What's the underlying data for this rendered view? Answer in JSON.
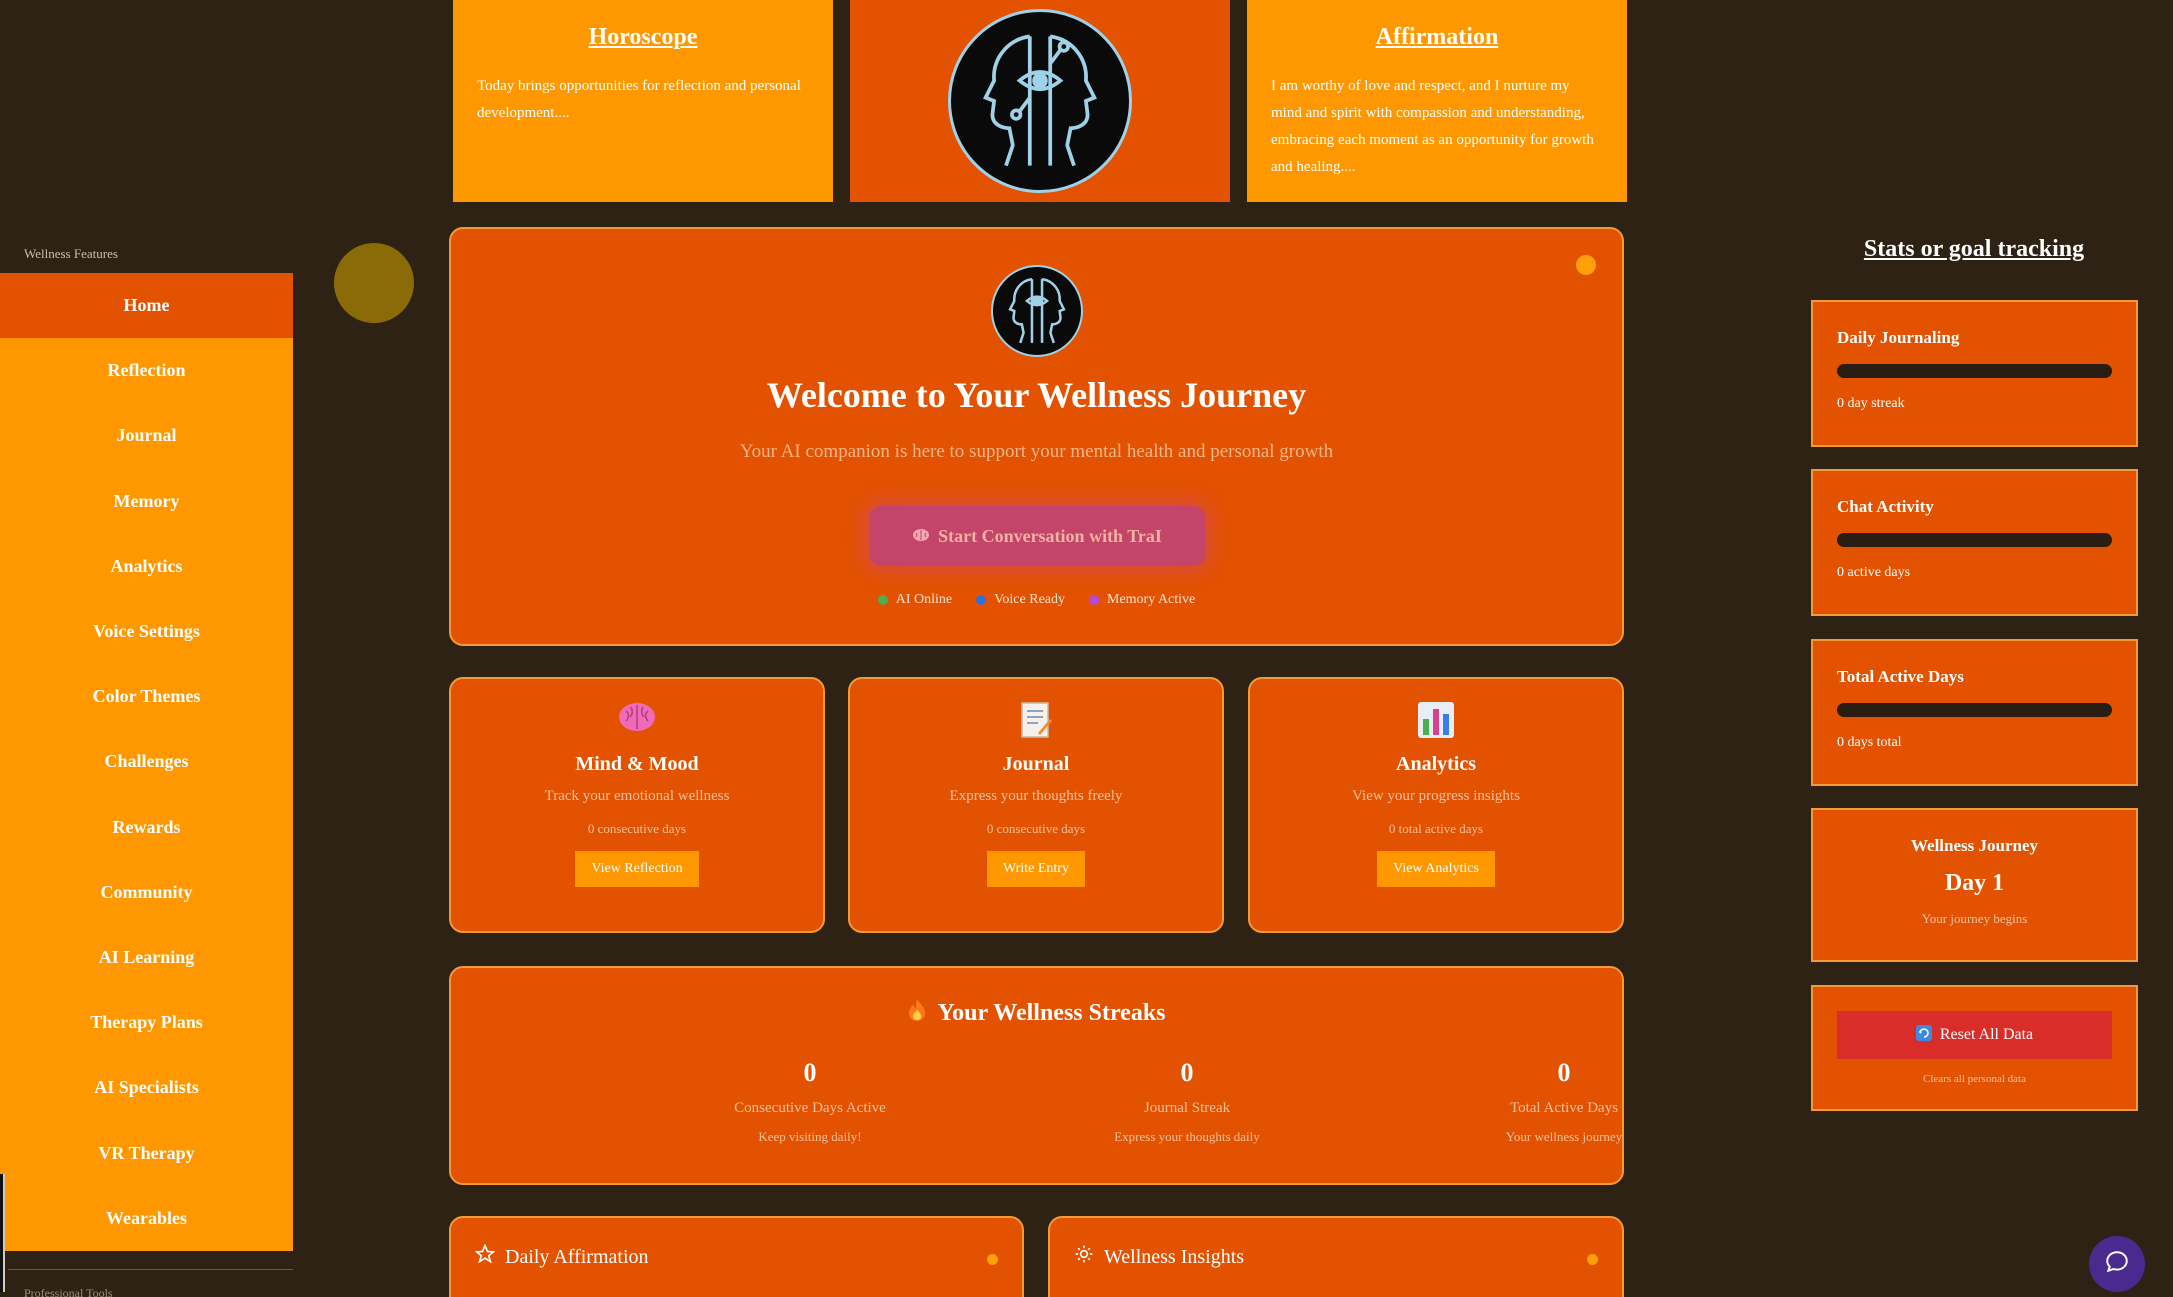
{
  "sidebar": {
    "title": "Wellness Features",
    "items": [
      {
        "label": "Home",
        "active": true
      },
      {
        "label": "Reflection"
      },
      {
        "label": "Journal"
      },
      {
        "label": "Memory"
      },
      {
        "label": "Analytics"
      },
      {
        "label": "Voice Settings"
      },
      {
        "label": "Color Themes"
      },
      {
        "label": "Challenges"
      },
      {
        "label": "Rewards"
      },
      {
        "label": "Community"
      },
      {
        "label": "AI Learning"
      },
      {
        "label": "Therapy Plans"
      },
      {
        "label": "AI Specialists"
      },
      {
        "label": "VR Therapy"
      },
      {
        "label": "Wearables"
      }
    ],
    "footer_label": "Professional Tools"
  },
  "top": {
    "horoscope": {
      "title": "Horoscope",
      "text": "Today brings opportunities for reflection and personal development...."
    },
    "affirmation": {
      "title": "Affirmation",
      "text": "I am worthy of love and respect, and I nurture my mind and spirit with compassion and understanding, embracing each moment as an opportunity for growth and healing...."
    },
    "logo_icon": "dual-face-ai-logo-icon"
  },
  "welcome": {
    "title": "Welcome to Your Wellness Journey",
    "subtitle": "Your AI companion is here to support your mental health and personal growth",
    "button_label": "Start Conversation with TraI",
    "button_icon": "brain-icon",
    "statuses": [
      {
        "label": "AI Online",
        "color": "#4caf50"
      },
      {
        "label": "Voice Ready",
        "color": "#2f6fd6"
      },
      {
        "label": "Memory Active",
        "color": "#b44ad9"
      }
    ]
  },
  "features": [
    {
      "icon": "brain-icon",
      "title": "Mind & Mood",
      "desc": "Track your emotional wellness",
      "count": "0 consecutive days",
      "button": "View Reflection"
    },
    {
      "icon": "memo-icon",
      "title": "Journal",
      "desc": "Express your thoughts freely",
      "count": "0 consecutive days",
      "button": "Write Entry"
    },
    {
      "icon": "bar-chart-icon",
      "title": "Analytics",
      "desc": "View your progress insights",
      "count": "0 total active days",
      "button": "View Analytics"
    }
  ],
  "streaks": {
    "title": "Your Wellness Streaks",
    "icon": "fire-icon",
    "items": [
      {
        "value": "0",
        "label": "Consecutive Days Active",
        "hint": "Keep visiting daily!"
      },
      {
        "value": "0",
        "label": "Journal Streak",
        "hint": "Express your thoughts daily"
      },
      {
        "value": "0",
        "label": "Total Active Days",
        "hint": "Your wellness journey"
      }
    ]
  },
  "bottom": {
    "affirmation_title": "Daily Affirmation",
    "insights_title": "Wellness Insights"
  },
  "stats": {
    "title": "Stats or goal tracking",
    "cards": [
      {
        "title": "Daily Journaling",
        "sub": "0 day streak",
        "progress": 0
      },
      {
        "title": "Chat Activity",
        "sub": "0 active days",
        "progress": 0
      },
      {
        "title": "Total Active Days",
        "sub": "0 days total",
        "progress": 0
      }
    ],
    "journey": {
      "title": "Wellness Journey",
      "day": "Day 1",
      "sub": "Your journey begins"
    },
    "reset": {
      "label": "Reset All Data",
      "note": "Clears all personal data",
      "icon": "refresh-icon"
    }
  },
  "colors": {
    "background": "#2d2214",
    "accent_orange": "#ff9800",
    "card_orange": "#e35200",
    "reset_red": "#d92d2a"
  }
}
